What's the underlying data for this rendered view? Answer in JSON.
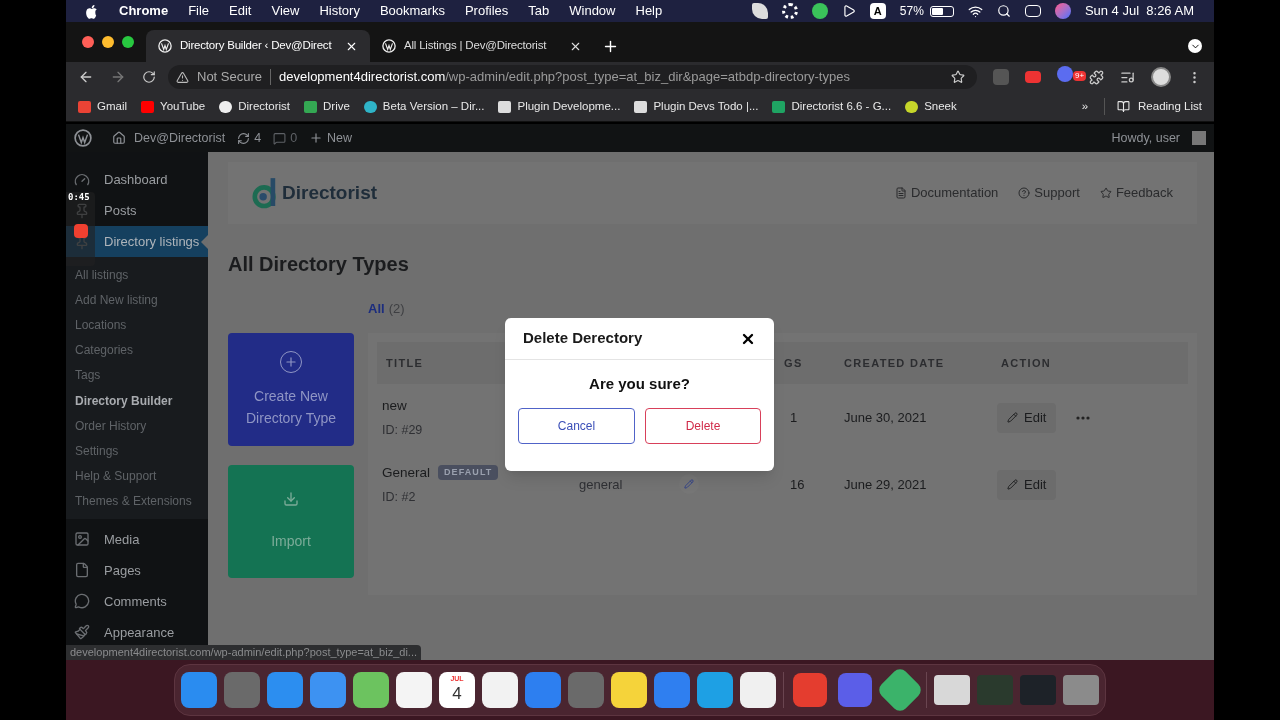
{
  "menubar": {
    "app": "Chrome",
    "items": [
      "File",
      "Edit",
      "View",
      "History",
      "Bookmarks",
      "Profiles",
      "Tab",
      "Window",
      "Help"
    ],
    "input_source": "A",
    "battery": "57%",
    "datetime": "Sun 4 Jul  8:26 AM"
  },
  "tabs": [
    {
      "title": "Directory Builder ‹ Dev@Direct",
      "selected": true
    },
    {
      "title": "All Listings | Dev@Directorist",
      "selected": false
    }
  ],
  "address": {
    "security": "Not Secure",
    "host": "development4directorist.com",
    "path": "/wp-admin/edit.php?post_type=at_biz_dir&page=atbdp-directory-types",
    "badge": "9+"
  },
  "bookmarks": [
    "Gmail",
    "YouTube",
    "Directorist",
    "Drive",
    "Beta Version – Dir...",
    "Plugin Developme...",
    "Plugin Devs Todo |...",
    "Directorist 6.6 - G...",
    "Sneek"
  ],
  "bookmarks_more": "»",
  "reading_list": "Reading List",
  "admin_bar": {
    "site": "Dev@Directorist",
    "updates": "4",
    "comments": "0",
    "new": "New",
    "howdy": "Howdy, user"
  },
  "recorder": {
    "time": "0:45"
  },
  "sidebar": {
    "items": [
      {
        "label": "Dashboard",
        "selected": false
      },
      {
        "label": "Posts",
        "selected": false
      },
      {
        "label": "Directory listings",
        "selected": true,
        "children": [
          {
            "label": "All listings",
            "selected": false
          },
          {
            "label": "Add New listing",
            "selected": false
          },
          {
            "label": "Locations",
            "selected": false
          },
          {
            "label": "Categories",
            "selected": false
          },
          {
            "label": "Tags",
            "selected": false
          },
          {
            "label": "Directory Builder",
            "selected": true
          },
          {
            "label": "Order History",
            "selected": false
          },
          {
            "label": "Settings",
            "selected": false
          },
          {
            "label": "Help & Support",
            "selected": false
          },
          {
            "label": "Themes & Extensions",
            "selected": false
          }
        ]
      },
      {
        "label": "Media",
        "selected": false
      },
      {
        "label": "Pages",
        "selected": false
      },
      {
        "label": "Comments",
        "selected": false
      },
      {
        "label": "Appearance",
        "selected": false
      }
    ]
  },
  "header": {
    "brand": "Directorist",
    "links": [
      "Documentation",
      "Support",
      "Feedback"
    ]
  },
  "page_title": "All Directory Types",
  "filter": {
    "label": "All",
    "count": "(2)"
  },
  "actions": [
    {
      "kind": "create",
      "label": "Create New Directory Type"
    },
    {
      "kind": "import",
      "label": "Import"
    }
  ],
  "table": {
    "columns": [
      "TITLE",
      "GS",
      "CREATED DATE",
      "ACTION"
    ],
    "rows": [
      {
        "title": "new",
        "id": "ID: #29",
        "count": "1",
        "created": "June 30, 2021",
        "action": "Edit",
        "more": true
      },
      {
        "title": "General",
        "badge": "DEFAULT",
        "id": "ID: #2",
        "slug": "general",
        "count": "16",
        "created": "June 29, 2021",
        "action": "Edit",
        "more": false
      }
    ]
  },
  "dialog": {
    "title": "Delete Derectory",
    "message": "Are you sure?",
    "cancel": "Cancel",
    "confirm": "Delete"
  },
  "status_url": "development4directorist.com/wp-admin/edit.php?post_type=at_biz_di...",
  "dock": {
    "calendar_month": "JUL",
    "calendar_day": "4"
  }
}
